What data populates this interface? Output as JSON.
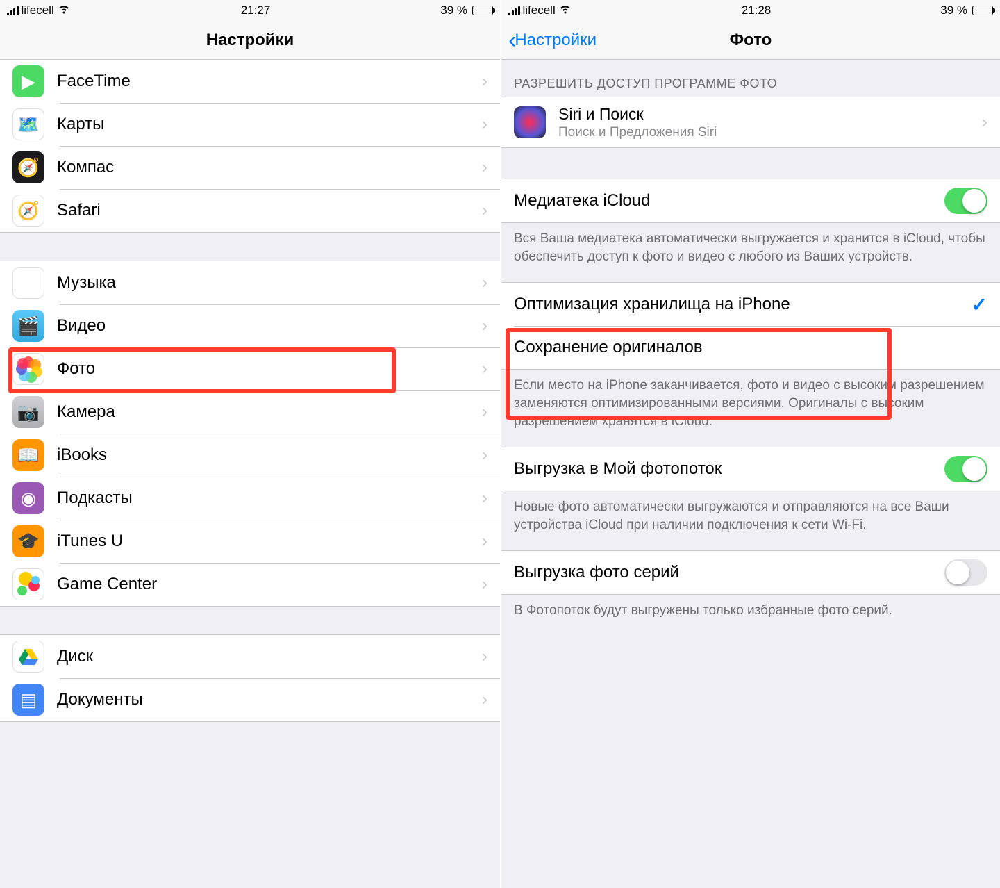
{
  "left": {
    "status": {
      "carrier": "lifecell",
      "time": "21:27",
      "battery_pct": "39 %"
    },
    "nav": {
      "title": "Настройки"
    },
    "group1": [
      {
        "id": "facetime",
        "label": "FaceTime"
      },
      {
        "id": "maps",
        "label": "Карты"
      },
      {
        "id": "compass",
        "label": "Компас"
      },
      {
        "id": "safari",
        "label": "Safari"
      }
    ],
    "group2": [
      {
        "id": "music",
        "label": "Музыка"
      },
      {
        "id": "videos",
        "label": "Видео"
      },
      {
        "id": "photos",
        "label": "Фото",
        "highlighted": true
      },
      {
        "id": "camera",
        "label": "Камера"
      },
      {
        "id": "ibooks",
        "label": "iBooks"
      },
      {
        "id": "podcasts",
        "label": "Подкасты"
      },
      {
        "id": "itunesu",
        "label": "iTunes U"
      },
      {
        "id": "gamecenter",
        "label": "Game Center"
      }
    ],
    "group3": [
      {
        "id": "drive",
        "label": "Диск"
      },
      {
        "id": "docs",
        "label": "Документы"
      }
    ]
  },
  "right": {
    "status": {
      "carrier": "lifecell",
      "time": "21:28",
      "battery_pct": "39 %"
    },
    "nav": {
      "back": "Настройки",
      "title": "Фото"
    },
    "access_header": "РАЗРЕШИТЬ ДОСТУП ПРОГРАММЕ ФОТО",
    "siri": {
      "title": "Siri и Поиск",
      "subtitle": "Поиск и Предложения Siri"
    },
    "icloud_library": {
      "label": "Медиатека iCloud",
      "on": true
    },
    "icloud_footer": "Вся Ваша медиатека автоматически выгружается и хранится в iCloud, чтобы обеспечить доступ к фото и видео с любого из Ваших устройств.",
    "storage_options": [
      {
        "label": "Оптимизация хранилища на iPhone",
        "checked": true
      },
      {
        "label": "Сохранение оригиналов",
        "checked": false
      }
    ],
    "storage_footer": "Если место на iPhone заканчивается, фото и видео с высоким разрешением заменяются оптимизированными версиями. Оригиналы с высоким разрешением хранятся в iCloud.",
    "photostream": {
      "label": "Выгрузка в Мой фотопоток",
      "on": true
    },
    "photostream_footer": "Новые фото автоматически выгружаются и отправляются на все Ваши устройства iCloud при наличии подключения к сети Wi-Fi.",
    "burst": {
      "label": "Выгрузка фото серий",
      "on": false
    },
    "burst_footer": "В Фотопоток будут выгружены только избранные фото серий."
  }
}
